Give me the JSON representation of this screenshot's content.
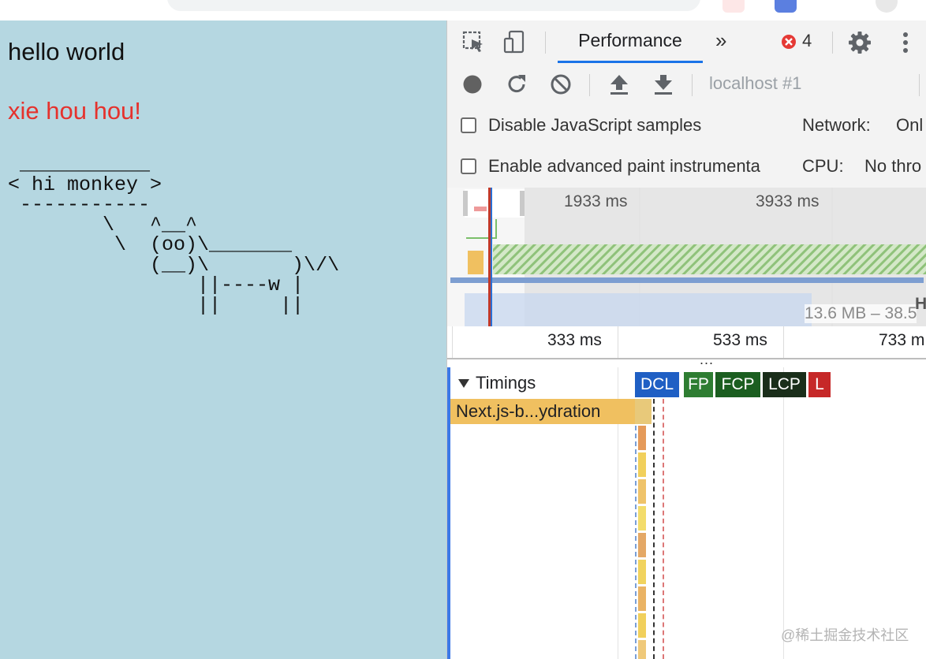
{
  "page": {
    "heading": "hello world",
    "subheading": "xie hou hou!",
    "cowsay": " ___________\n< hi monkey >\n -----------\n        \\   ^__^\n         \\  (oo)\\_______\n            (__)\\       )\\/\\\n                ||----w |\n                ||     ||"
  },
  "devtools": {
    "tabs": {
      "active_label": "Performance",
      "more_label": "»",
      "error_count": "4"
    },
    "toolbar": {
      "recording_label": "localhost #1"
    },
    "settings": {
      "disable_js_samples": "Disable JavaScript samples",
      "enable_paint": "Enable advanced paint instrumenta",
      "network_label": "Network:",
      "network_value": "Onl",
      "cpu_label": "CPU:",
      "cpu_value": "No thro"
    },
    "overview": {
      "tick1": "1933 ms",
      "tick2": "3933 ms",
      "heap": "13.6 MB – 38.5",
      "heap_label": "H"
    },
    "ruler": {
      "t1": "333 ms",
      "t2": "533 ms",
      "t3": "733 m",
      "ellipsis": "..."
    },
    "timings": {
      "track_label": "Timings",
      "markers": [
        "DCL",
        "FP",
        "FCP",
        "LCP",
        "L"
      ],
      "entry_label": "Next.js-b...ydration"
    }
  },
  "icons": [
    "inspect-element-icon",
    "device-toolbar-icon",
    "error-icon",
    "settings-gear-icon",
    "more-vert-icon",
    "record-icon",
    "reload-icon",
    "clear-icon",
    "upload-icon",
    "download-icon"
  ],
  "colors": {
    "page_background": "#b5d7e1",
    "red_text": "#e5322d",
    "tab_accent": "#1a73e8",
    "dcl": "#1f5fc4",
    "fp": "#2e7d32",
    "fcp": "#1b5e20",
    "lcp": "#1a2e1a",
    "load": "#c62828",
    "flame_entry": "#f0c060"
  },
  "watermark": "@稀土掘金技术社区"
}
